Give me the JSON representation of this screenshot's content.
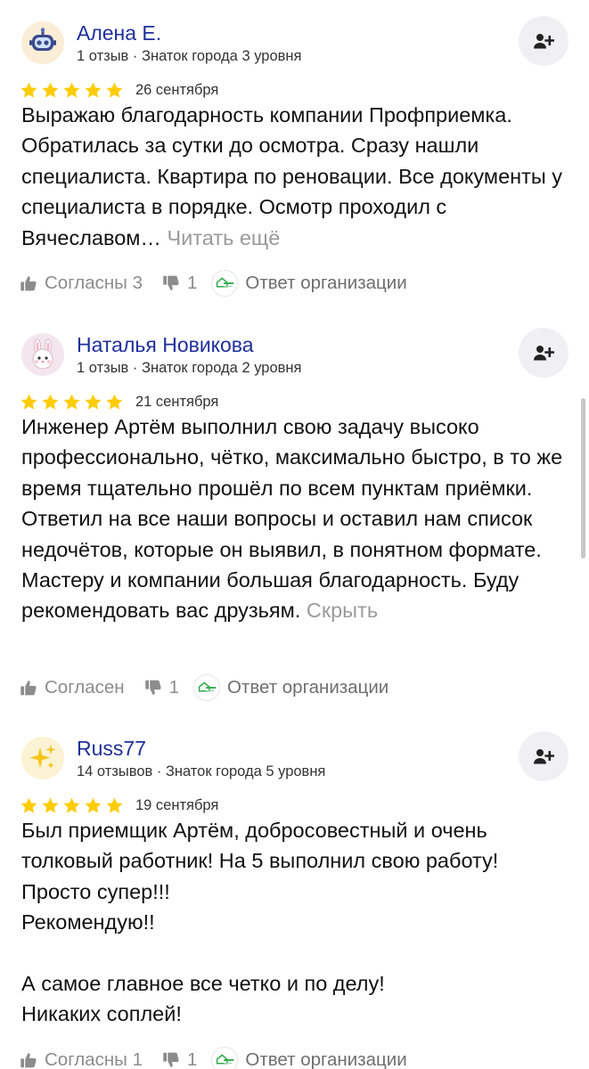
{
  "reviews": [
    {
      "avatar_icon": "robot-emoji-icon",
      "author": "Алена Е.",
      "meta": "1 отзыв · Знаток города 3 уровня",
      "rating": 5,
      "date": "26 сентября",
      "text": "Выражаю благодарность компании Профприемка. Обратилась за сутки до осмотра. Сразу нашли специалиста. Квартира по реновации. Все документы у специалиста в порядке. Осмотр проходил с Вячеславом… ",
      "toggle": "Читать ещё",
      "like": "Согласны 3",
      "dislike": "1",
      "reply": "Ответ организации"
    },
    {
      "avatar_icon": "bunny-emoji-icon",
      "author": "Наталья Новикова",
      "meta": "1 отзыв · Знаток города 2 уровня",
      "rating": 5,
      "date": "21 сентября",
      "text": "Инженер Артём выполнил свою задачу высоко профессионально, чётко, максимально быстро, в то же время тщательно прошёл по всем пунктам приёмки. Ответил на все наши вопросы и оставил нам список недочётов, которые он выявил, в понятном формате.\nМастеру и компании большая благодарность. Буду рекомендовать вас друзьям. ",
      "toggle": "Скрыть",
      "like": "Согласен",
      "dislike": "1",
      "reply": "Ответ организации"
    },
    {
      "avatar_icon": "sparkles-emoji-icon",
      "author": "Russ77",
      "meta": "14 отзывов · Знаток города 5 уровня",
      "rating": 5,
      "date": "19 сентября",
      "text": "Был приемщик Артём, добросовестный и очень толковый работник! На 5 выполнил свою работу! Просто супер!!!\nРекомендую!!\n\nА самое главное все четко и по делу!\nНикаких соплей!",
      "toggle": "",
      "like": "Согласны 1",
      "dislike": "1",
      "reply": "Ответ организации"
    }
  ],
  "colors": {
    "author_name": "#1f2f9c",
    "star": "#ffcc00",
    "muted": "#8c8c8c",
    "button_bg": "#f0f0f2"
  }
}
